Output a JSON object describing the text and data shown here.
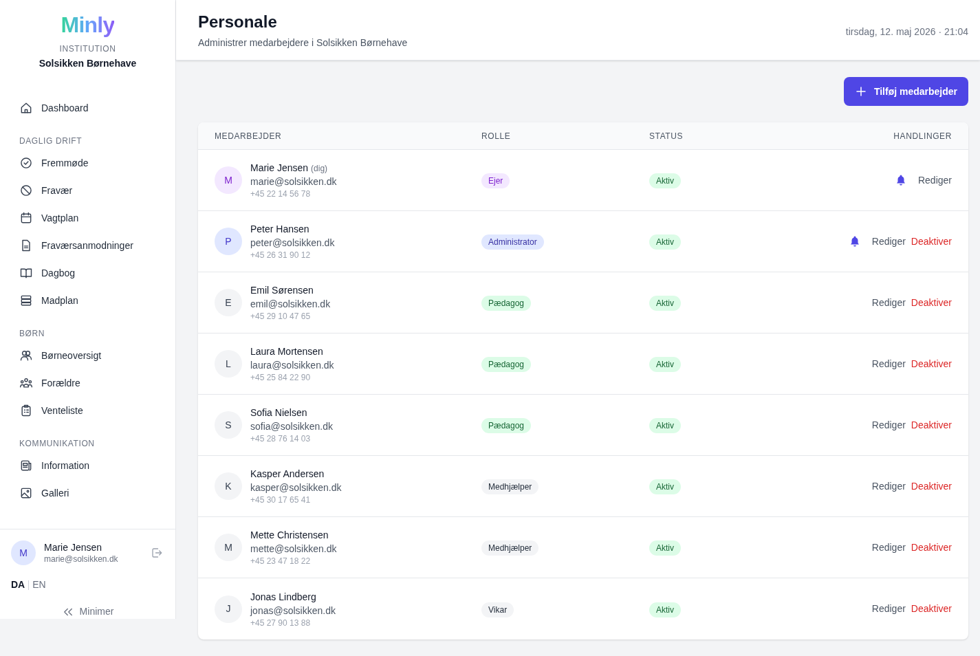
{
  "sidebar": {
    "logo": "Minly",
    "institution_label": "INSTITUTION",
    "institution_name": "Solsikken Børnehave",
    "sections": [
      {
        "items": [
          {
            "label": "Dashboard"
          }
        ]
      },
      {
        "title": "DAGLIG DRIFT",
        "items": [
          {
            "label": "Fremmøde"
          },
          {
            "label": "Fravær"
          },
          {
            "label": "Vagtplan"
          },
          {
            "label": "Fraværsanmodninger"
          },
          {
            "label": "Dagbog"
          },
          {
            "label": "Madplan"
          }
        ]
      },
      {
        "title": "BØRN",
        "items": [
          {
            "label": "Børneoversigt"
          },
          {
            "label": "Forældre"
          },
          {
            "label": "Venteliste"
          }
        ]
      },
      {
        "title": "KOMMUNIKATION",
        "items": [
          {
            "label": "Information"
          },
          {
            "label": "Galleri"
          }
        ]
      }
    ],
    "user": {
      "initial": "M",
      "name": "Marie Jensen",
      "email": "marie@solsikken.dk"
    },
    "languages": [
      {
        "label": "DA",
        "selected": true
      },
      {
        "label": "EN",
        "selected": false
      }
    ],
    "minimize": "Minimer"
  },
  "header": {
    "title": "Personale",
    "subtitle": "Administrer medarbejdere i Solsikken Børnehave",
    "datetime": "tirsdag, 12. maj 2026 · 21:04"
  },
  "add_button": "Tilføj medarbejder",
  "table": {
    "columns": [
      "MEDARBEJDER",
      "ROLLE",
      "STATUS",
      "HANDLINGER"
    ],
    "rows": [
      {
        "initial": "M",
        "name": "Marie Jensen",
        "note": "(dig)",
        "email": "marie@solsikken.dk",
        "phone": "+45 22 14 56 78",
        "role": "Ejer",
        "kind": "owner",
        "status": "Aktiv",
        "notify": true,
        "actions": [
          {
            "label": "Rediger",
            "kind": "edit"
          }
        ]
      },
      {
        "initial": "P",
        "name": "Peter Hansen",
        "email": "peter@solsikken.dk",
        "phone": "+45 26 31 90 12",
        "role": "Administrator",
        "kind": "admin",
        "status": "Aktiv",
        "notify": true,
        "actions": [
          {
            "label": "Rediger",
            "kind": "edit"
          },
          {
            "label": "Deaktiver",
            "kind": "deactivate"
          }
        ]
      },
      {
        "initial": "E",
        "name": "Emil Sørensen",
        "email": "emil@solsikken.dk",
        "phone": "+45 29 10 47 65",
        "role": "Pædagog",
        "kind": "pedagogue",
        "status": "Aktiv",
        "notify": false,
        "actions": [
          {
            "label": "Rediger",
            "kind": "edit"
          },
          {
            "label": "Deaktiver",
            "kind": "deactivate"
          }
        ]
      },
      {
        "initial": "L",
        "name": "Laura Mortensen",
        "email": "laura@solsikken.dk",
        "phone": "+45 25 84 22 90",
        "role": "Pædagog",
        "kind": "pedagogue",
        "status": "Aktiv",
        "notify": false,
        "actions": [
          {
            "label": "Rediger",
            "kind": "edit"
          },
          {
            "label": "Deaktiver",
            "kind": "deactivate"
          }
        ]
      },
      {
        "initial": "S",
        "name": "Sofia Nielsen",
        "email": "sofia@solsikken.dk",
        "phone": "+45 28 76 14 03",
        "role": "Pædagog",
        "kind": "pedagogue",
        "status": "Aktiv",
        "notify": false,
        "actions": [
          {
            "label": "Rediger",
            "kind": "edit"
          },
          {
            "label": "Deaktiver",
            "kind": "deactivate"
          }
        ]
      },
      {
        "initial": "K",
        "name": "Kasper Andersen",
        "email": "kasper@solsikken.dk",
        "phone": "+45 30 17 65 41",
        "role": "Medhjælper",
        "kind": "helper",
        "status": "Aktiv",
        "notify": false,
        "actions": [
          {
            "label": "Rediger",
            "kind": "edit"
          },
          {
            "label": "Deaktiver",
            "kind": "deactivate"
          }
        ]
      },
      {
        "initial": "M",
        "name": "Mette Christensen",
        "email": "mette@solsikken.dk",
        "phone": "+45 23 47 18 22",
        "role": "Medhjælper",
        "kind": "helper",
        "status": "Aktiv",
        "notify": false,
        "actions": [
          {
            "label": "Rediger",
            "kind": "edit"
          },
          {
            "label": "Deaktiver",
            "kind": "deactivate"
          }
        ]
      },
      {
        "initial": "J",
        "name": "Jonas Lindberg",
        "email": "jonas@solsikken.dk",
        "phone": "+45 27 90 13 88",
        "role": "Vikar",
        "kind": "substitute",
        "status": "Aktiv",
        "notify": false,
        "actions": [
          {
            "label": "Rediger",
            "kind": "edit"
          },
          {
            "label": "Deaktiver",
            "kind": "deactivate"
          }
        ]
      }
    ]
  }
}
